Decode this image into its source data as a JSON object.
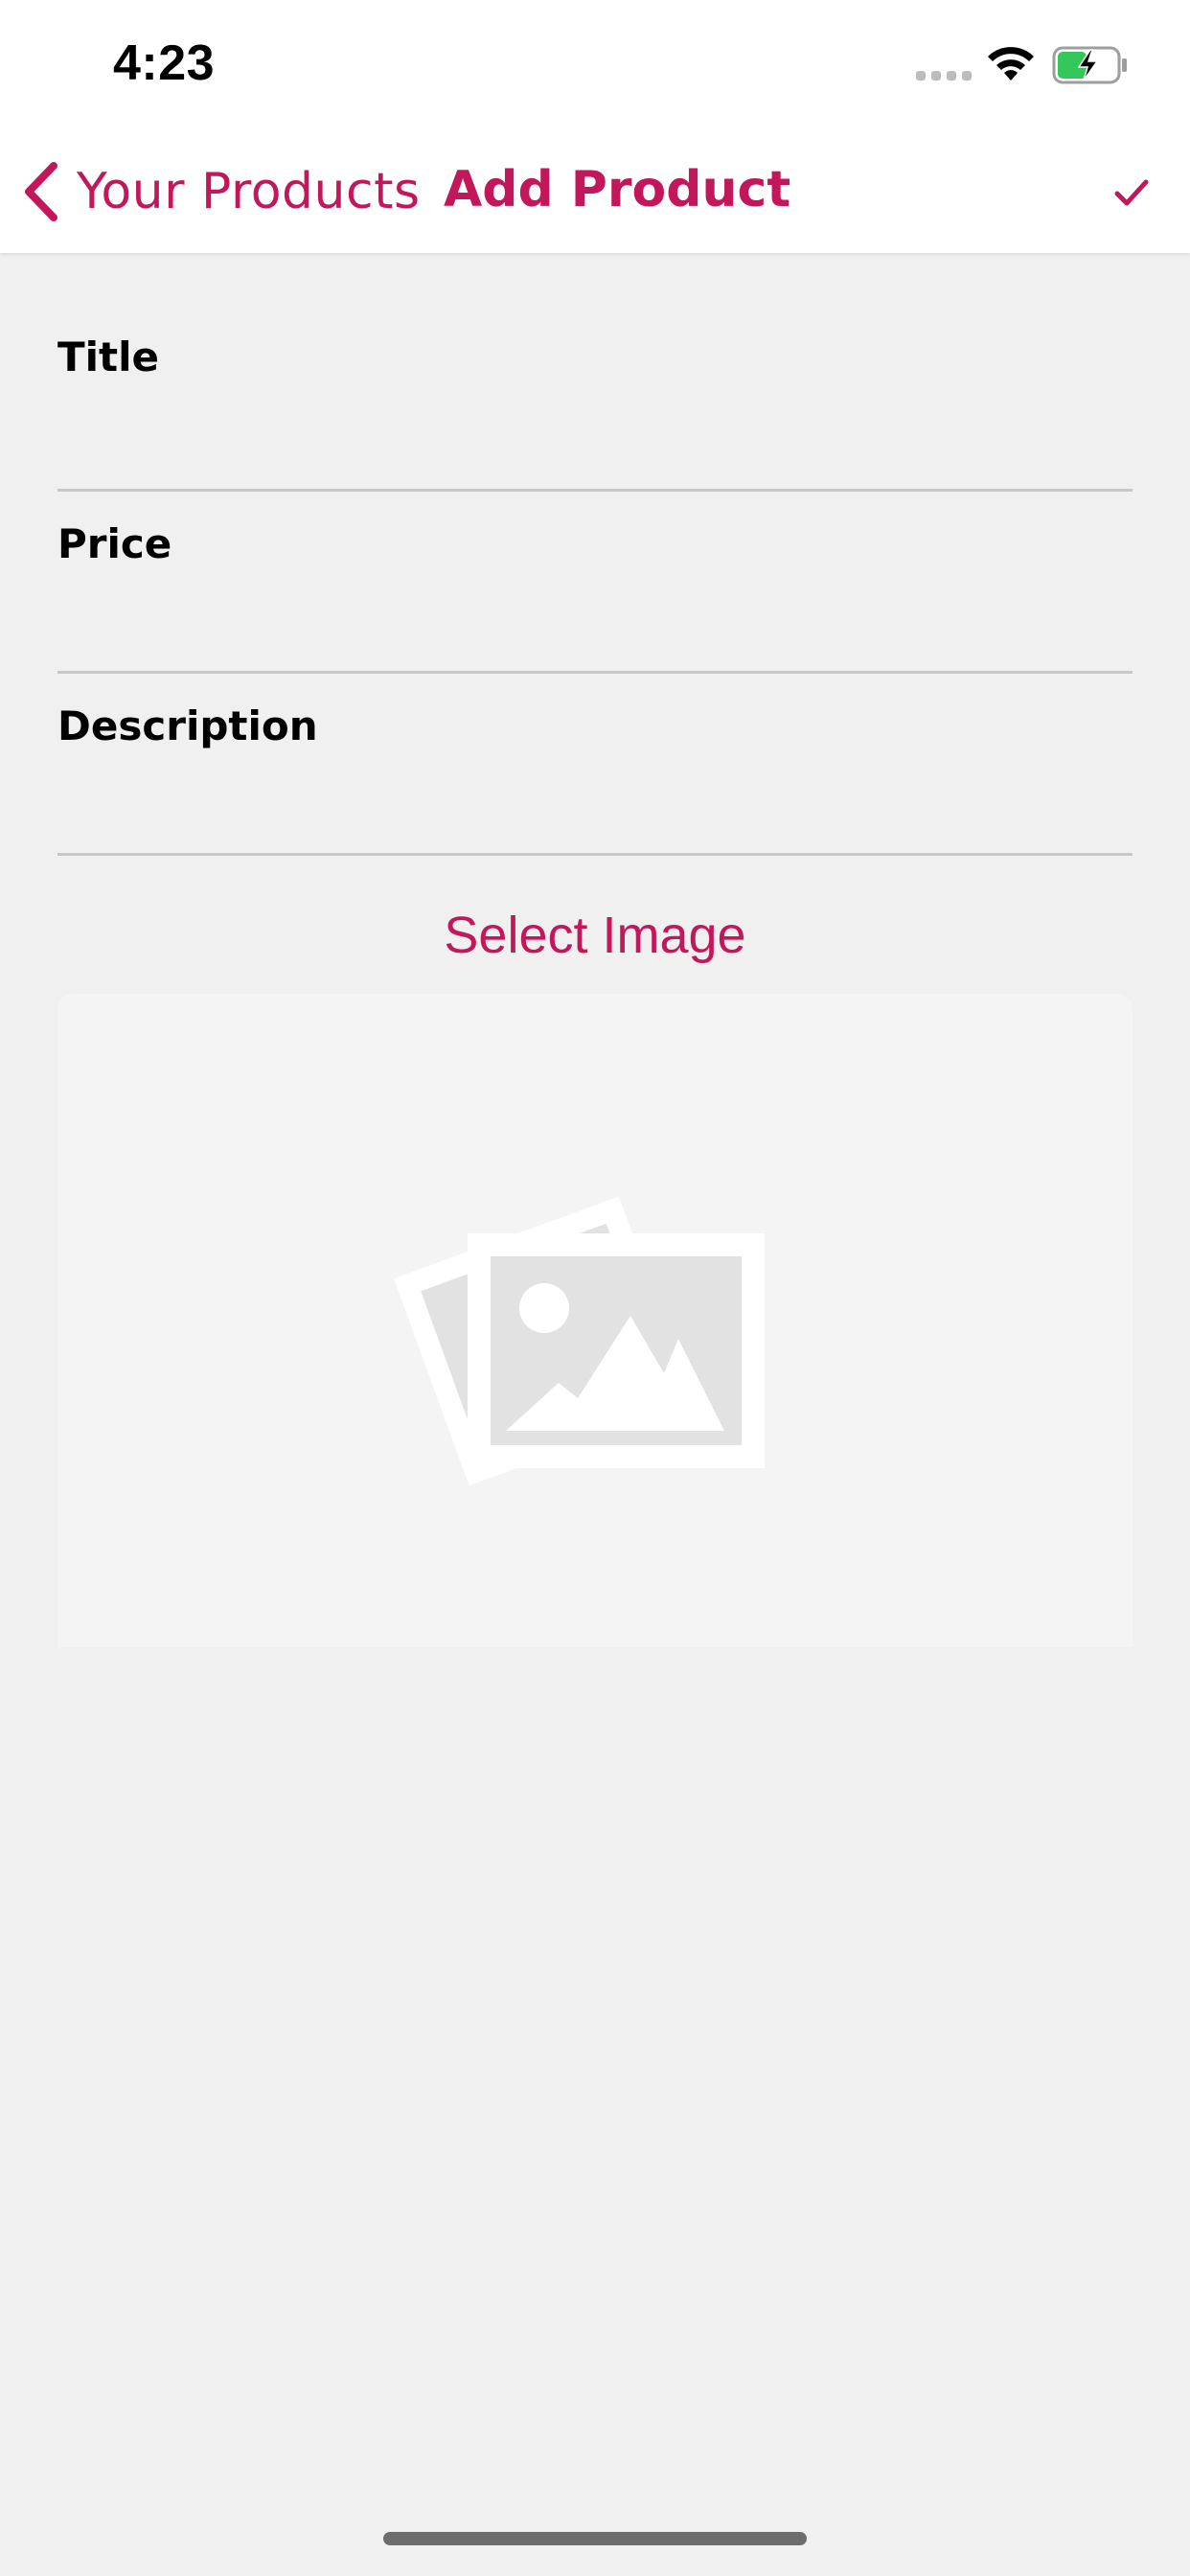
{
  "status_bar": {
    "time": "4:23",
    "icons": [
      "signal-dots-icon",
      "wifi-icon",
      "battery-charging-icon"
    ]
  },
  "nav_bar": {
    "back_label": "Your Products",
    "title": "Add Product",
    "save_icon": "checkmark-icon"
  },
  "form": {
    "title": {
      "label": "Title",
      "value": "",
      "placeholder": ""
    },
    "price": {
      "label": "Price",
      "value": "",
      "placeholder": ""
    },
    "description": {
      "label": "Description",
      "value": "",
      "placeholder": ""
    }
  },
  "image_picker": {
    "button_label": "Select Image",
    "placeholder_icon": "image-placeholder-icon"
  },
  "colors": {
    "accent": "#c2185b",
    "background": "#f0f0f0",
    "header_background": "#ffffff",
    "battery_fill": "#34c759"
  }
}
